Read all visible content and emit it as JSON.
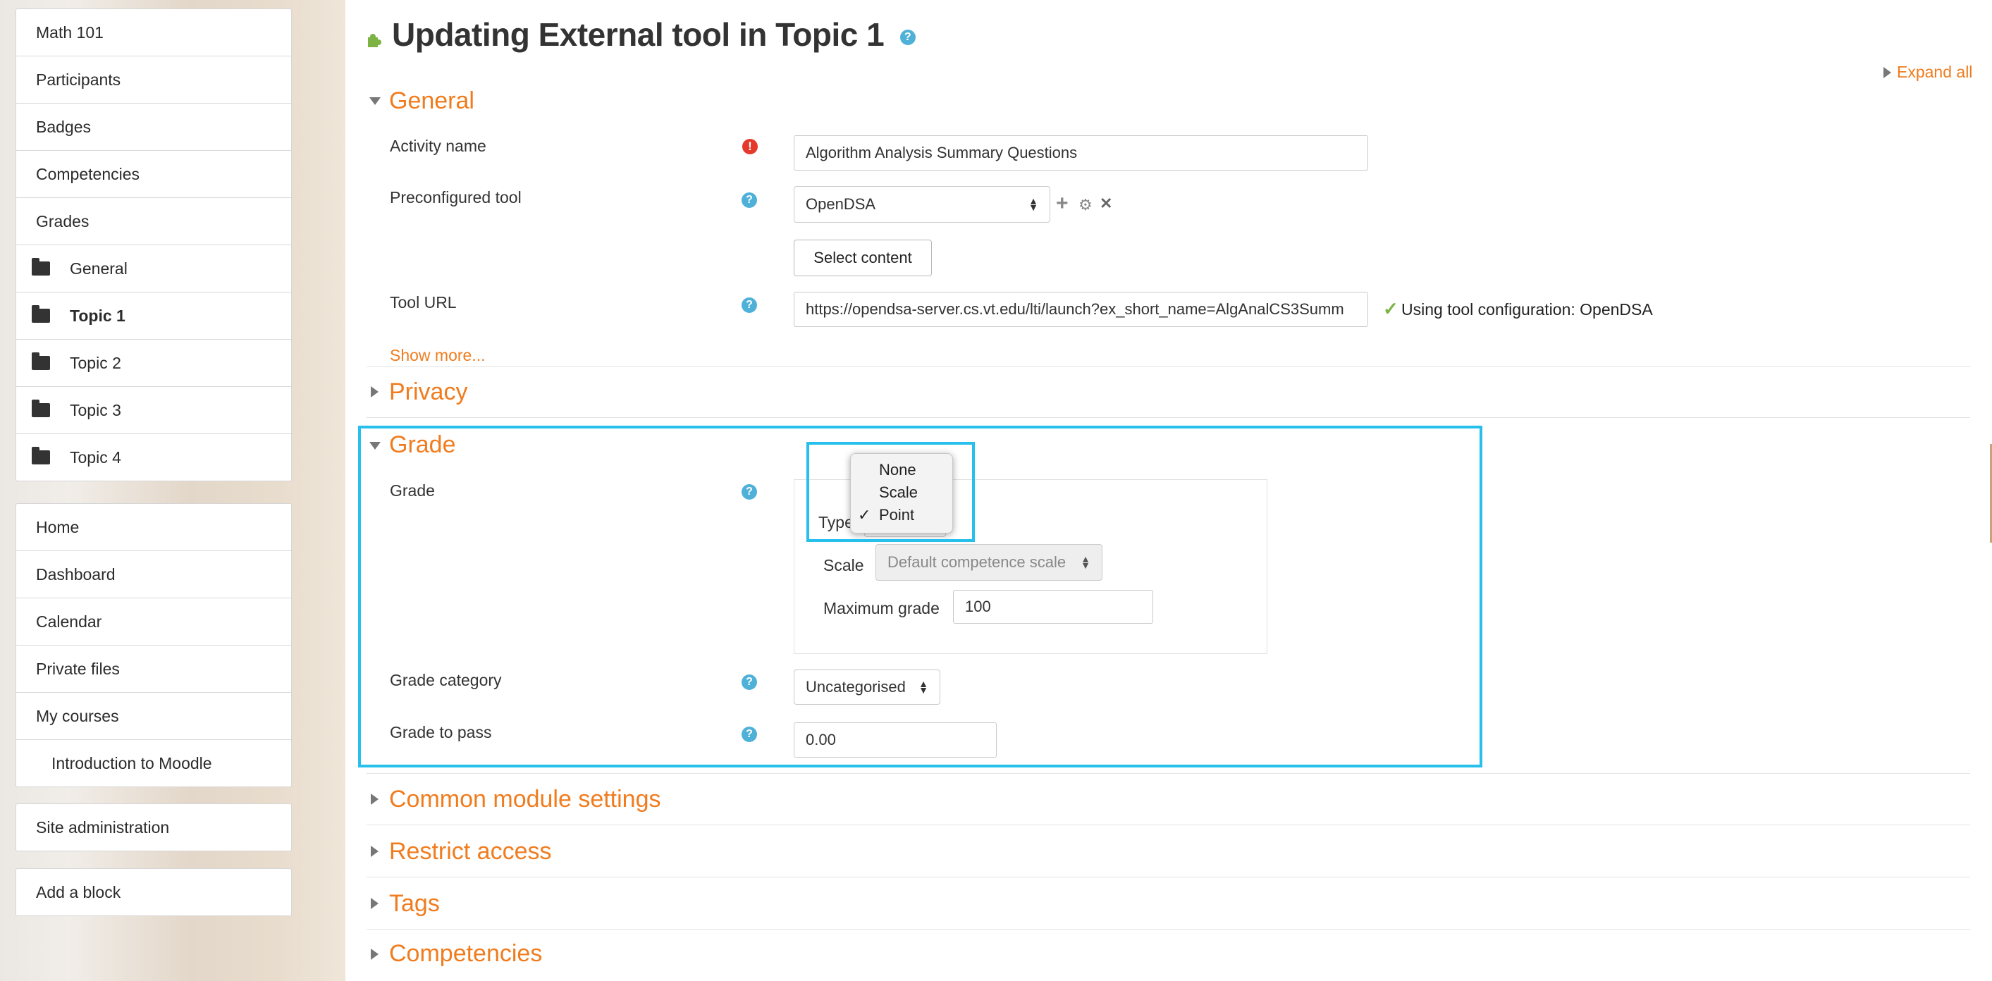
{
  "sidebar": {
    "course_items": [
      {
        "label": "Math 101"
      },
      {
        "label": "Participants"
      },
      {
        "label": "Badges"
      },
      {
        "label": "Competencies"
      },
      {
        "label": "Grades"
      },
      {
        "label": "General"
      },
      {
        "label": "Topic 1",
        "active": true
      },
      {
        "label": "Topic 2"
      },
      {
        "label": "Topic 3"
      },
      {
        "label": "Topic 4"
      }
    ],
    "nav_items": [
      {
        "label": "Home"
      },
      {
        "label": "Dashboard"
      },
      {
        "label": "Calendar"
      },
      {
        "label": "Private files"
      },
      {
        "label": "My courses"
      },
      {
        "label": "Introduction to Moodle"
      }
    ],
    "site_admin": "Site administration",
    "add_block": "Add a block"
  },
  "page": {
    "title": "Updating External tool in Topic 1",
    "expand_all": "Expand all"
  },
  "general": {
    "heading": "General",
    "activity_name_label": "Activity name",
    "activity_name_value": "Algorithm Analysis Summary Questions",
    "preconfigured_label": "Preconfigured tool",
    "preconfigured_value": "OpenDSA",
    "select_content": "Select content",
    "tool_url_label": "Tool URL",
    "tool_url_value": "https://opendsa-server.cs.vt.edu/lti/launch?ex_short_name=AlgAnalCS3Summ",
    "tool_config_text": "Using tool configuration: OpenDSA",
    "show_more": "Show more..."
  },
  "privacy": {
    "heading": "Privacy"
  },
  "grade": {
    "heading": "Grade",
    "grade_label": "Grade",
    "type_label": "Type",
    "type_options": [
      "None",
      "Scale",
      "Point"
    ],
    "type_selected": "Point",
    "scale_label": "Scale",
    "scale_value": "Default competence scale",
    "max_grade_label": "Maximum grade",
    "max_grade_value": "100",
    "category_label": "Grade category",
    "category_value": "Uncategorised",
    "to_pass_label": "Grade to pass",
    "to_pass_value": "0.00"
  },
  "collapsed_sections": {
    "common": "Common module settings",
    "restrict": "Restrict access",
    "tags": "Tags",
    "competencies": "Competencies"
  },
  "icons": {
    "help": "?",
    "error": "!",
    "check": "✓",
    "add": "+",
    "gear": "⚙",
    "close": "✕"
  },
  "colors": {
    "accent_orange": "#f07c1e",
    "help_blue": "#4fb1d8",
    "highlight_cyan": "#27bfec",
    "error_red": "#e5392b",
    "check_green": "#7cb342"
  }
}
